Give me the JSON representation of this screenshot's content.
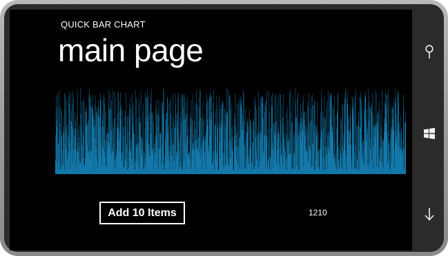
{
  "app": {
    "title": "QUICK BAR CHART",
    "page_title": "main page"
  },
  "controls": {
    "add_button_label": "Add 10 Items",
    "item_count": "1210"
  },
  "hardware_buttons": [
    {
      "name": "search",
      "icon": "search-icon"
    },
    {
      "name": "start",
      "icon": "windows-logo-icon"
    },
    {
      "name": "back",
      "icon": "back-arrow-icon"
    }
  ],
  "colors": {
    "accent": "#1ba1e2",
    "background": "#000000",
    "foreground": "#ffffff",
    "device_frame": "#a8a8a8"
  },
  "chart_data": {
    "type": "bar",
    "bar_count": 1210,
    "value_range": [
      0,
      1
    ],
    "color": "#1ba1e2",
    "title": "",
    "xlabel": "",
    "ylabel": ""
  }
}
